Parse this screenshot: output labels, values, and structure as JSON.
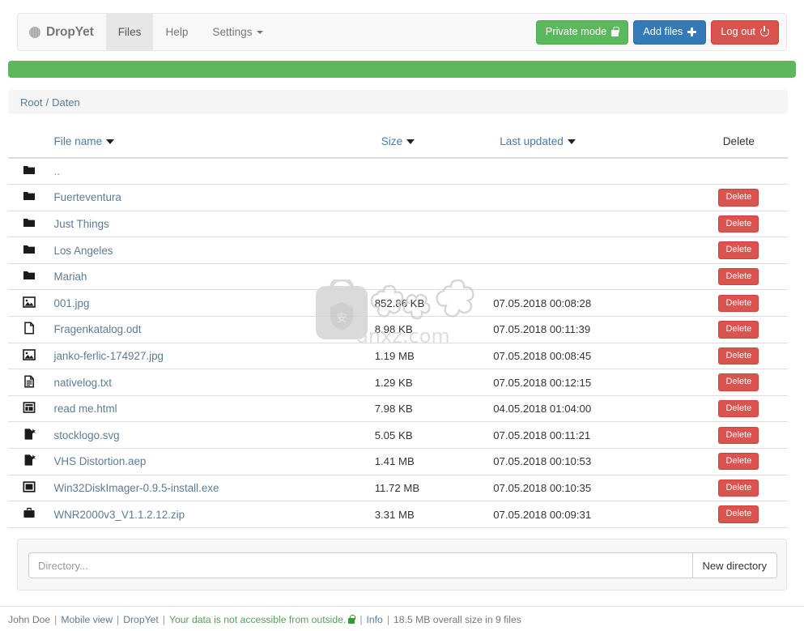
{
  "navbar": {
    "brand": "DropYet",
    "brand_icon": "circle-logo-icon",
    "links": [
      {
        "label": "Files",
        "active": true
      },
      {
        "label": "Help",
        "active": false
      },
      {
        "label": "Settings",
        "active": false,
        "caret": true
      }
    ],
    "buttons": [
      {
        "label": "Private mode",
        "icon": "lock-icon",
        "color": "#5cb85c"
      },
      {
        "label": "Add files",
        "icon": "plus-icon",
        "color": "#337ab7"
      },
      {
        "label": "Log out",
        "icon": "power-icon",
        "color": "#d9534f"
      }
    ]
  },
  "progress": {
    "percent": 100,
    "color": "#5cb85c"
  },
  "breadcrumb": {
    "root": "Root",
    "separator": "/",
    "current": "Daten"
  },
  "table": {
    "headers": {
      "icon": "",
      "name": "File name",
      "size": "Size",
      "updated": "Last updated",
      "delete": "Delete"
    },
    "delete_label": "Delete",
    "rows": [
      {
        "icon": "folder-icon",
        "name": "..",
        "is_link": false,
        "size": "",
        "updated": "",
        "deletable": false
      },
      {
        "icon": "folder-icon",
        "name": "Fuerteventura",
        "is_link": true,
        "size": "",
        "updated": "",
        "deletable": true
      },
      {
        "icon": "folder-icon",
        "name": "Just Things",
        "is_link": true,
        "size": "",
        "updated": "",
        "deletable": true
      },
      {
        "icon": "folder-icon",
        "name": "Los Angeles",
        "is_link": true,
        "size": "",
        "updated": "",
        "deletable": true
      },
      {
        "icon": "folder-icon",
        "name": "Mariah",
        "is_link": true,
        "size": "",
        "updated": "",
        "deletable": true
      },
      {
        "icon": "image-icon",
        "name": "001.jpg",
        "is_link": true,
        "size": "852.86 KB",
        "updated": "07.05.2018 00:08:28",
        "deletable": true
      },
      {
        "icon": "document-icon",
        "name": "Fragenkatalog.odt",
        "is_link": true,
        "size": "8.98 KB",
        "updated": "07.05.2018 00:11:39",
        "deletable": true
      },
      {
        "icon": "image-icon",
        "name": "janko-ferlic-174927.jpg",
        "is_link": true,
        "size": "1.19 MB",
        "updated": "07.05.2018 00:08:45",
        "deletable": true
      },
      {
        "icon": "textfile-icon",
        "name": "nativelog.txt",
        "is_link": true,
        "size": "1.29 KB",
        "updated": "07.05.2018 00:12:15",
        "deletable": true
      },
      {
        "icon": "html-icon",
        "name": "read me.html",
        "is_link": true,
        "size": "7.98 KB",
        "updated": "04.05.2018 01:04:00",
        "deletable": true
      },
      {
        "icon": "code-icon",
        "name": "stocklogo.svg",
        "is_link": true,
        "size": "5.05 KB",
        "updated": "07.05.2018 00:11:21",
        "deletable": true
      },
      {
        "icon": "code-icon",
        "name": "VHS Distortion.aep",
        "is_link": true,
        "size": "1.41 MB",
        "updated": "07.05.2018 00:10:53",
        "deletable": true
      },
      {
        "icon": "application-icon",
        "name": "Win32DiskImager-0.9.5-install.exe",
        "is_link": true,
        "size": "11.72 MB",
        "updated": "07.05.2018 00:10:35",
        "deletable": true
      },
      {
        "icon": "archive-icon",
        "name": "WNR2000v3_V1.1.2.12.zip",
        "is_link": true,
        "size": "3.31 MB",
        "updated": "07.05.2018 00:09:31",
        "deletable": true
      }
    ]
  },
  "new_directory": {
    "placeholder": "Directory...",
    "value": "",
    "button_label": "New directory"
  },
  "footer": {
    "user": "John Doe",
    "mobile_view": "Mobile view",
    "app": "DropYet",
    "security_message": "Your data is not accessible from outside.",
    "security_icon": "lock-icon",
    "info": "Info",
    "storage_summary": "18.5 MB overall size in 9 files",
    "separator": "|"
  },
  "watermark": {
    "text": "anxz.com"
  }
}
